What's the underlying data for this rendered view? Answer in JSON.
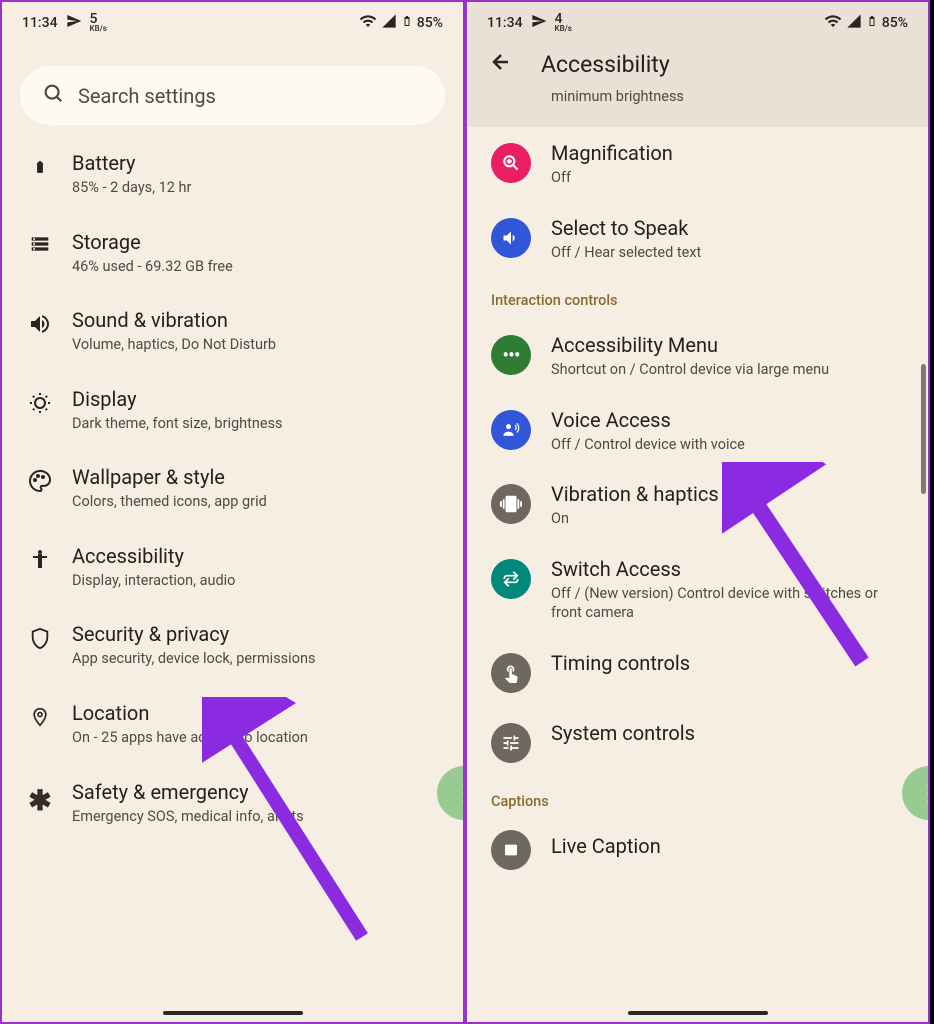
{
  "status": {
    "time": "11:34",
    "speed_num": "5",
    "speed_unit": "KB/s",
    "battery": "85%"
  },
  "search": {
    "placeholder": "Search settings"
  },
  "settings": [
    {
      "title": "Battery",
      "subtitle": "85% - 2 days, 12 hr"
    },
    {
      "title": "Storage",
      "subtitle": "46% used - 69.32 GB free"
    },
    {
      "title": "Sound & vibration",
      "subtitle": "Volume, haptics, Do Not Disturb"
    },
    {
      "title": "Display",
      "subtitle": "Dark theme, font size, brightness"
    },
    {
      "title": "Wallpaper & style",
      "subtitle": "Colors, themed icons, app grid"
    },
    {
      "title": "Accessibility",
      "subtitle": "Display, interaction, audio"
    },
    {
      "title": "Security & privacy",
      "subtitle": "App security, device lock, permissions"
    },
    {
      "title": "Location",
      "subtitle": "On - 25 apps have access to location"
    },
    {
      "title": "Safety & emergency",
      "subtitle": "Emergency SOS, medical info, alerts"
    }
  ],
  "screen2": {
    "status_speed_num": "4",
    "header_title": "Accessibility",
    "header_sub": "minimum brightness",
    "sections": {
      "items_top": [
        {
          "title": "Magnification",
          "subtitle": "Off"
        },
        {
          "title": "Select to Speak",
          "subtitle": "Off / Hear selected text"
        }
      ],
      "interaction_header": "Interaction controls",
      "interaction_items": [
        {
          "title": "Accessibility Menu",
          "subtitle": "Shortcut on / Control device via large menu"
        },
        {
          "title": "Voice Access",
          "subtitle": "Off / Control device with voice"
        },
        {
          "title": "Vibration & haptics",
          "subtitle": "On"
        },
        {
          "title": "Switch Access",
          "subtitle": "Off / (New version) Control device with switches or front camera"
        },
        {
          "title": "Timing controls",
          "subtitle": ""
        },
        {
          "title": "System controls",
          "subtitle": ""
        }
      ],
      "captions_header": "Captions",
      "captions_items": [
        {
          "title": "Live Caption",
          "subtitle": ""
        }
      ]
    }
  }
}
